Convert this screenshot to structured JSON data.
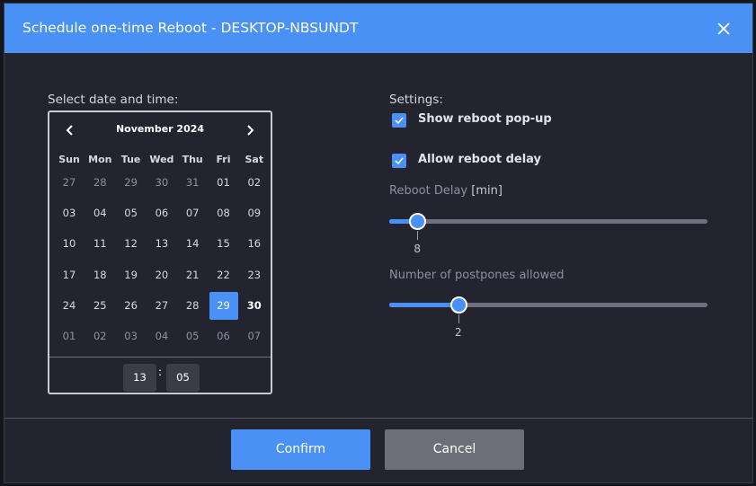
{
  "dialog": {
    "title": "Schedule one-time Reboot - DESKTOP-NBSUNDT",
    "close_icon": "close-icon",
    "accent_color": "#4a91f5"
  },
  "datetime": {
    "label": "Select date and time:",
    "calendar": {
      "month_label": "November 2024",
      "prev_icon": "chevron-left-icon",
      "next_icon": "chevron-right-icon",
      "weekdays": [
        "Sun",
        "Mon",
        "Tue",
        "Wed",
        "Thu",
        "Fri",
        "Sat"
      ],
      "weeks": [
        [
          "27",
          "28",
          "29",
          "30",
          "31",
          "01",
          "02"
        ],
        [
          "03",
          "04",
          "05",
          "06",
          "07",
          "08",
          "09"
        ],
        [
          "10",
          "11",
          "12",
          "13",
          "14",
          "15",
          "16"
        ],
        [
          "17",
          "18",
          "19",
          "20",
          "21",
          "22",
          "23"
        ],
        [
          "24",
          "25",
          "26",
          "27",
          "28",
          "29",
          "30"
        ],
        [
          "01",
          "02",
          "03",
          "04",
          "05",
          "06",
          "07"
        ]
      ],
      "selected": "29"
    },
    "time": {
      "hour": "13",
      "separator": ":",
      "minute": "05"
    }
  },
  "settings": {
    "label": "Settings:",
    "show_popup": {
      "label": "Show reboot pop-up",
      "checked": true
    },
    "allow_delay": {
      "label": "Allow reboot delay",
      "checked": true
    },
    "reboot_delay": {
      "label": "Reboot Delay",
      "unit": "[min]",
      "value": "8",
      "fraction": 0.088
    },
    "postpones": {
      "label": "Number of postpones allowed",
      "value": "2",
      "fraction": 0.217
    }
  },
  "footer": {
    "confirm_label": "Confirm",
    "cancel_label": "Cancel"
  }
}
